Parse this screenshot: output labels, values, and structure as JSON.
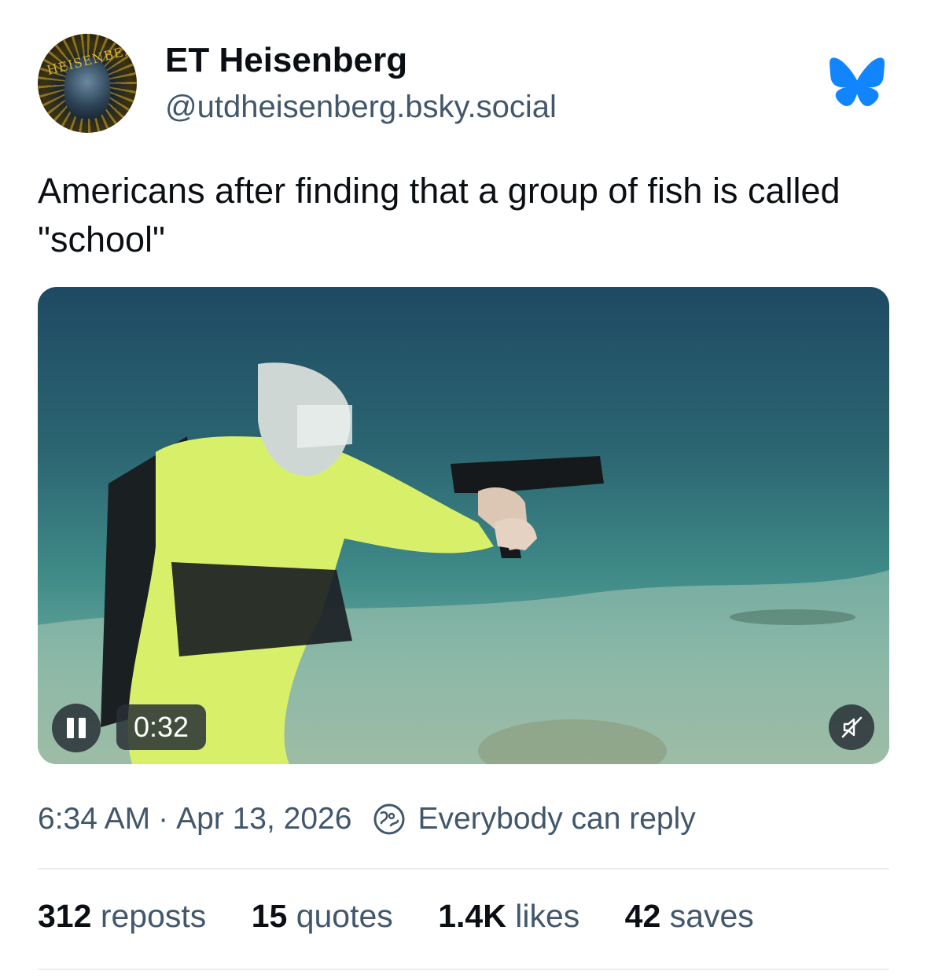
{
  "author": {
    "display_name": "ET Heisenberg",
    "handle": "@utdheisenberg.bsky.social",
    "avatar_text": "HEISENBERG"
  },
  "logo_icon": "bluesky-butterfly-icon",
  "post": {
    "text": "Americans after finding that a group of fish is called \"school\""
  },
  "video": {
    "timestamp": "0:32",
    "pause_icon": "pause-icon",
    "mute_icon": "speaker-muted-icon"
  },
  "meta": {
    "time": "6:34 AM",
    "separator": "·",
    "date": "Apr 13, 2026",
    "reply_setting": "Everybody can reply"
  },
  "stats": {
    "reposts_count": "312",
    "reposts_label": "reposts",
    "quotes_count": "15",
    "quotes_label": "quotes",
    "likes_count": "1.4K",
    "likes_label": "likes",
    "saves_count": "42",
    "saves_label": "saves"
  },
  "colors": {
    "accent": "#1185fe",
    "text_primary": "#0b0f14",
    "text_secondary": "#42576c"
  }
}
